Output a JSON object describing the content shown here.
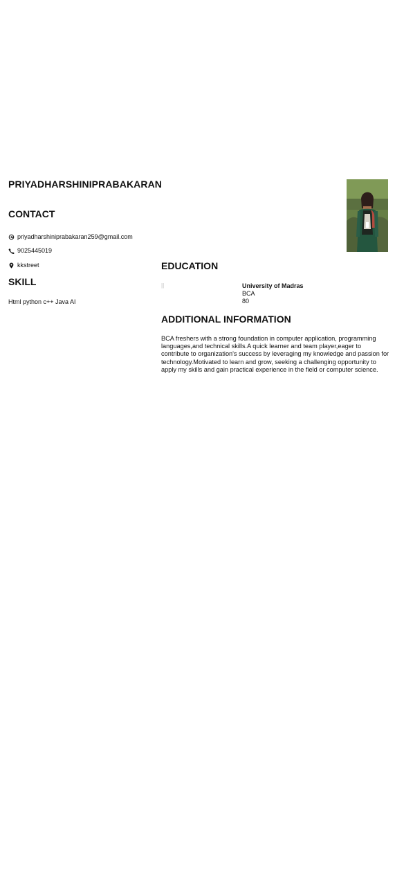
{
  "resume": {
    "name": "PRIYADHARSHINIPRABAKARAN",
    "photo_alt": "profile photo",
    "contact": {
      "heading": "CONTACT",
      "email": "priyadharshiniprabakaran259@gmail.com",
      "phone": "9025445019",
      "address": "kkstreet"
    },
    "skill": {
      "heading": "SKILL",
      "text": "Html python c++ Java AI"
    },
    "education": {
      "heading": "EDUCATION",
      "dates": "||",
      "school": "University of Madras",
      "degree": "BCA",
      "score": "80"
    },
    "additional": {
      "heading": "ADDITIONAL INFORMATION",
      "text": "BCA freshers with a strong foundation in computer application, programming languages,and technical skills.A quick learner and team player,eager to contribute to organization's success by leveraging my knowledge and passion for technology.Motivated to learn and grow, seeking a challenging opportunity to apply my skills and gain practical experience in the field or computer science."
    },
    "icons": {
      "email": "at-icon",
      "phone": "phone-icon",
      "location": "location-pin-icon"
    }
  }
}
